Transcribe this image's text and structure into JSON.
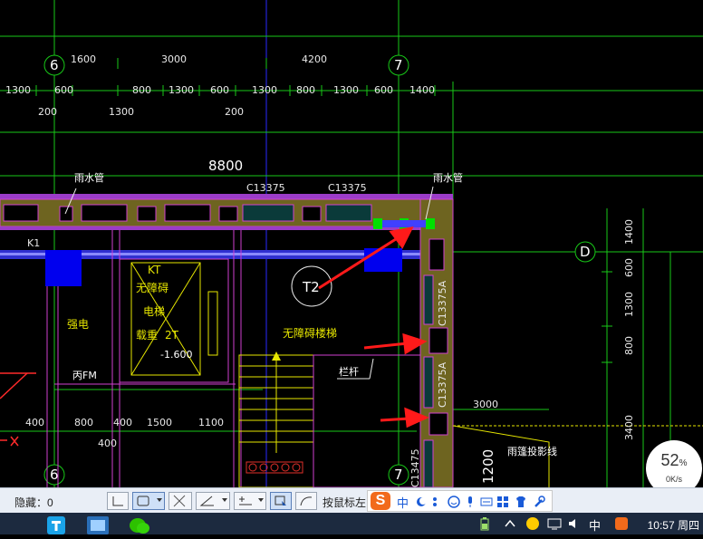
{
  "drawing": {
    "axis_top_left": "6",
    "axis_top_right": "7",
    "axis_bottom_left": "6",
    "axis_bottom_right": "7",
    "axis_right": "D",
    "row1": [
      "1600",
      "3000",
      "4200"
    ],
    "row2": [
      "1300",
      "600",
      "800",
      "1300",
      "600",
      "1300",
      "800",
      "1300",
      "600",
      "1400"
    ],
    "row3": [
      "200",
      "1300",
      "200"
    ],
    "overall": "8800",
    "window_top_1": "C13375",
    "window_top_2": "C13375",
    "window_right_1": "C13375A",
    "window_right_2": "C13375A",
    "window_right_3": "C13475",
    "drain_left": "雨水管",
    "drain_right": "雨水管",
    "k1": "K1",
    "kt": "KT",
    "elevator_1": "无障碍",
    "elevator_2": "电梯",
    "elevator_3": "载重",
    "elevator_4": "2T",
    "elevator_level": "-1.600",
    "room_power": "强电",
    "fire_cabinet": "丙FM",
    "t2": "T2",
    "stair_label": "无障碍楼梯",
    "rail": "栏杆",
    "right_dims": [
      "1400",
      "600",
      "1300",
      "800",
      "3400"
    ],
    "bottom_dims": [
      "400",
      "800",
      "400",
      "1500",
      "1100"
    ],
    "bottom_dim_2": "400",
    "dim_3000": "3000",
    "dim_1200": "1200",
    "canopy": "雨篷投影线"
  },
  "statusbar": {
    "hidden_label": "隐藏：0",
    "cursor_text": "按鼠标左",
    "ime_logo": "S",
    "ime_lang": "中"
  },
  "taskbar": {
    "clock": "10:57 周四",
    "tray_lang": "中"
  },
  "speed": {
    "percent": "52",
    "percent_unit": "%",
    "rate": "0K/s"
  }
}
